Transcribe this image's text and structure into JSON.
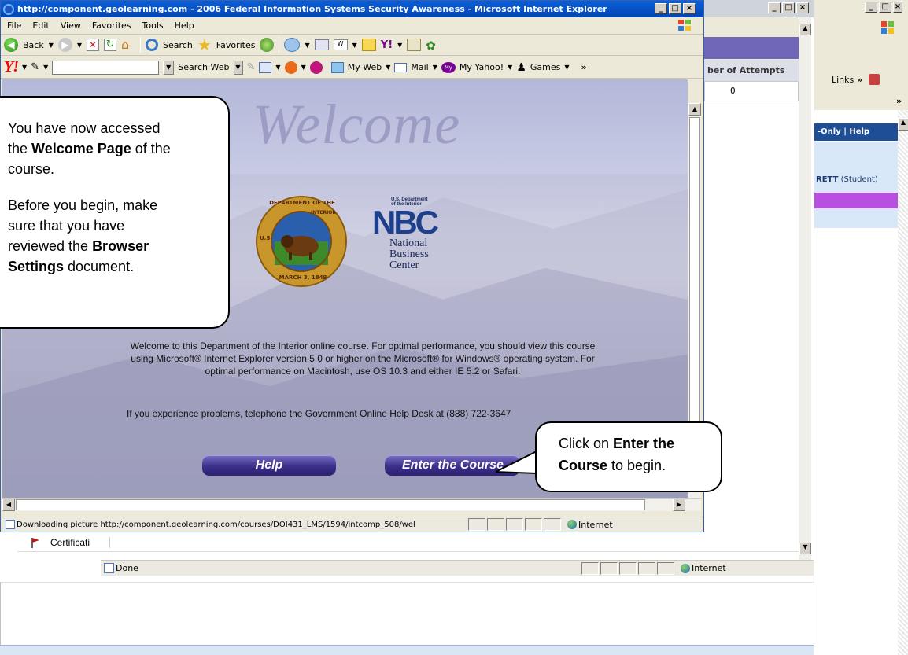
{
  "front_window": {
    "title": "http://component.geolearning.com - 2006 Federal Information Systems Security Awareness - Microsoft Internet Explorer",
    "controls": [
      "_",
      "□",
      "×"
    ],
    "menu": [
      "File",
      "Edit",
      "View",
      "Favorites",
      "Tools",
      "Help"
    ],
    "nav": {
      "back": "Back",
      "search": "Search",
      "favorites": "Favorites"
    },
    "yahoo": {
      "search_btn": "Search Web",
      "myweb": "My Web",
      "mail": "Mail",
      "myyahoo": "My Yahoo!",
      "games": "Games",
      "more": "»"
    },
    "status": {
      "text": "Downloading picture http://component.geolearning.com/courses/DOI431_LMS/1594/intcomp_508/wel",
      "zone": "Internet"
    }
  },
  "page": {
    "welcome_heading": "Welcome",
    "seal": {
      "top": "DEPARTMENT OF THE",
      "top2": "INTERIOR",
      "bottom": "MARCH 3, 1849",
      "side": "U.S."
    },
    "nbc": {
      "dept": "U.S. Department",
      "dept2": "of the Interior",
      "mark": "NBC",
      "line1": "National",
      "line2": "Business",
      "line3": "Center"
    },
    "intro1": "Welcome to this Department of the Interior online course. For optimal performance, you should view this course",
    "intro2": "using Microsoft® Internet Explorer version 5.0 or higher on the Microsoft® for Windows® operating system. For",
    "intro3": "optimal performance on Macintosh, use OS 10.3 and either IE 5.2 or Safari.",
    "help_desk": "If you experience problems, telephone the Government Online Help Desk at (888) 722-3647",
    "help_button": "Help",
    "enter_button": "Enter the Course"
  },
  "callouts": {
    "welcome": {
      "l1": "You have now accessed",
      "l2a": "the ",
      "l2b": "Welcome Page",
      "l2c": " of the",
      "l3": "course.",
      "l4": "Before you begin, make",
      "l5": "sure that you have",
      "l6a": "reviewed the ",
      "l6b": "Browser",
      "l7a": "Settings",
      "l7b": " document."
    },
    "enter": {
      "l1": "Click on ",
      "l1b": "Enter the",
      "l2b": "Course",
      "l2": " to begin."
    }
  },
  "middle_window": {
    "table_header": "ber of Attempts",
    "table_value": "0",
    "row_item": "Certificati",
    "status_text": "Done",
    "zone": "Internet"
  },
  "back_window": {
    "links": "Links",
    "links_more": "»",
    "more": "»",
    "nav_text": "-Only  |  Help",
    "user": "RETT",
    "user_role": " (Student)"
  },
  "colors": {
    "xp_blue": "#0a5fd8",
    "button_purple": "#3b2f8a",
    "user_band": "#b84fe0",
    "panel_blue": "#d8e8f8"
  }
}
